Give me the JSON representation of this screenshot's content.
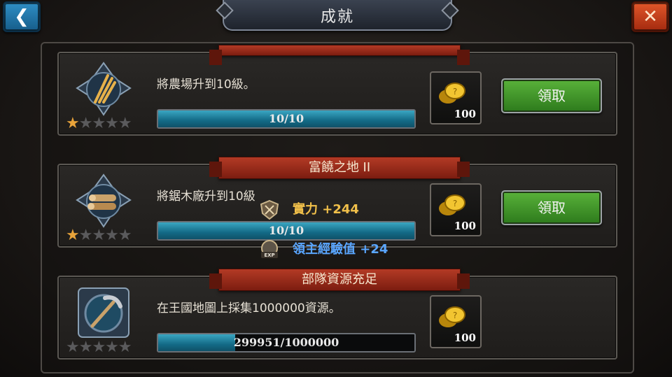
{
  "header": {
    "title": "成就",
    "back_icon": "back-arrow-icon",
    "close_icon": "close-x-icon"
  },
  "achievements": [
    {
      "banner": "",
      "description": "將農場升到10級。",
      "progress_text": "10/10",
      "progress": 1.0,
      "stars_filled": 1,
      "stars_total": 5,
      "reward_amount": "100",
      "reward_icon": "gold-coins-icon",
      "emblem_icon": "wheat-emblem-icon",
      "claim_label": "領取"
    },
    {
      "banner": "富饒之地 II",
      "description": "將鋸木廠升到10級",
      "progress_text": "10/10",
      "progress": 1.0,
      "stars_filled": 1,
      "stars_total": 5,
      "reward_amount": "100",
      "reward_icon": "gold-coins-icon",
      "emblem_icon": "lumber-emblem-icon",
      "claim_label": "領取"
    },
    {
      "banner": "部隊資源充足",
      "description": "在王國地圖上採集1000000資源。",
      "progress_text": "299951/1000000",
      "progress": 0.29995,
      "stars_filled": 0,
      "stars_total": 5,
      "reward_amount": "100",
      "reward_icon": "gold-coins-icon",
      "emblem_icon": "pickaxe-emblem-icon",
      "claim_label": ""
    }
  ],
  "popups": {
    "power": "實力 +244",
    "exp": "領主經驗值 +24",
    "exp_badge": "EXP"
  },
  "colors": {
    "claim_green": "#4aa02e",
    "banner_red": "#a3321f",
    "progress_teal": "#2a8eae",
    "gold_text": "#f1c04a",
    "exp_blue": "#5aa6ff"
  }
}
